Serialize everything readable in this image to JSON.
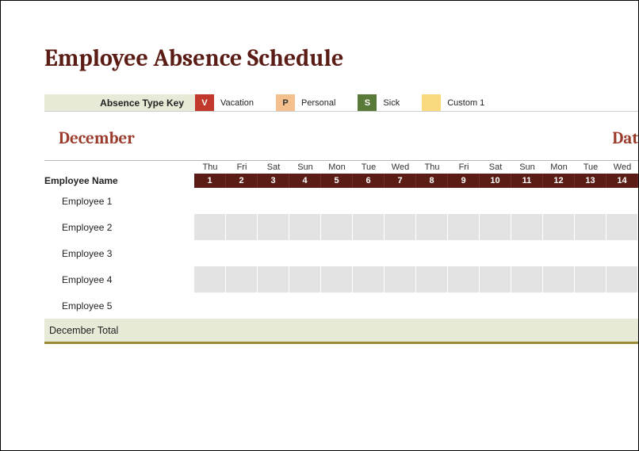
{
  "title": "Employee Absence Schedule",
  "legend": {
    "label": "Absence Type Key",
    "items": [
      {
        "code": "V",
        "text": "Vacation",
        "swatch": "sw-v"
      },
      {
        "code": "P",
        "text": "Personal",
        "swatch": "sw-p"
      },
      {
        "code": "S",
        "text": "Sick",
        "swatch": "sw-s"
      },
      {
        "code": "",
        "text": "Custom 1",
        "swatch": "sw-c"
      }
    ]
  },
  "schedule": {
    "month": "December",
    "date_label": "Dat",
    "employee_header": "Employee Name",
    "days": [
      {
        "dow": "Thu",
        "num": "1"
      },
      {
        "dow": "Fri",
        "num": "2"
      },
      {
        "dow": "Sat",
        "num": "3"
      },
      {
        "dow": "Sun",
        "num": "4"
      },
      {
        "dow": "Mon",
        "num": "5"
      },
      {
        "dow": "Tue",
        "num": "6"
      },
      {
        "dow": "Wed",
        "num": "7"
      },
      {
        "dow": "Thu",
        "num": "8"
      },
      {
        "dow": "Fri",
        "num": "9"
      },
      {
        "dow": "Sat",
        "num": "10"
      },
      {
        "dow": "Sun",
        "num": "11"
      },
      {
        "dow": "Mon",
        "num": "12"
      },
      {
        "dow": "Tue",
        "num": "13"
      },
      {
        "dow": "Wed",
        "num": "14"
      }
    ],
    "employees": [
      {
        "name": "Employee 1"
      },
      {
        "name": "Employee 2"
      },
      {
        "name": "Employee 3"
      },
      {
        "name": "Employee 4"
      },
      {
        "name": "Employee 5"
      }
    ],
    "total_label": "December Total"
  }
}
